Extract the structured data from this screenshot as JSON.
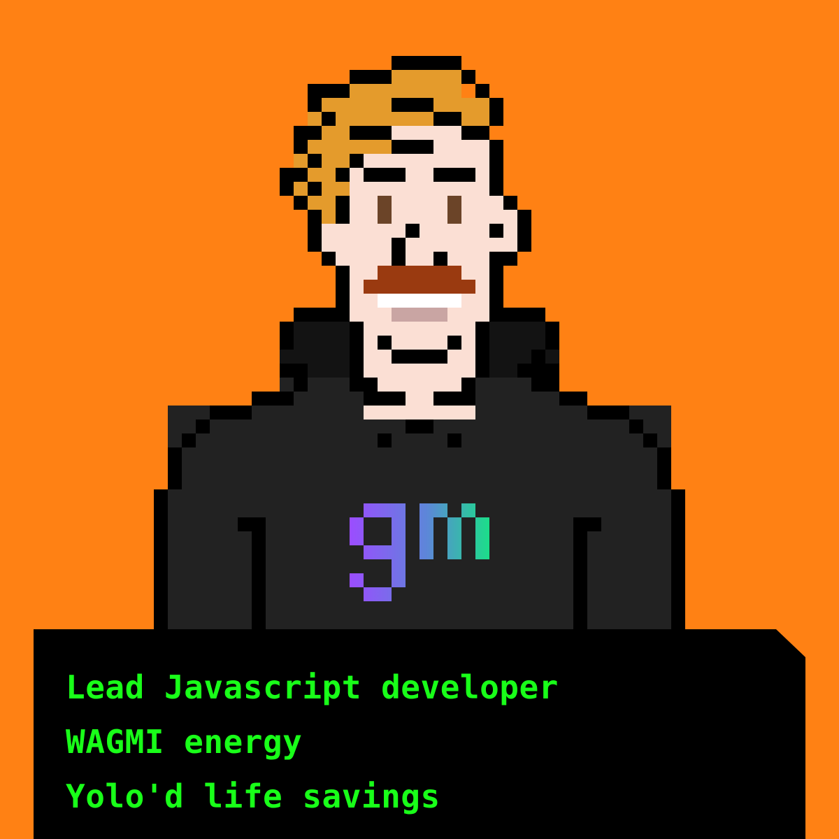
{
  "colors": {
    "background": "#ff8114",
    "outline": "#000000",
    "hair": "#e49b2c",
    "skin": "#fbdfd4",
    "eye": "#6b4428",
    "mustache": "#9a3a10",
    "teeth": "#ffffff",
    "gum": "#c9a5a3",
    "hoodie": "#222222",
    "hoodie_dark": "#131313",
    "gm_gradient": [
      "#9b4dff",
      "#5d86d9",
      "#1cdd8a"
    ],
    "caption_background": "#000000",
    "caption_text": "#19ff19"
  },
  "logo": {
    "text": "gm"
  },
  "traits": [
    "Lead Javascript developer",
    "WAGMI energy",
    "Yolo'd life savings"
  ]
}
